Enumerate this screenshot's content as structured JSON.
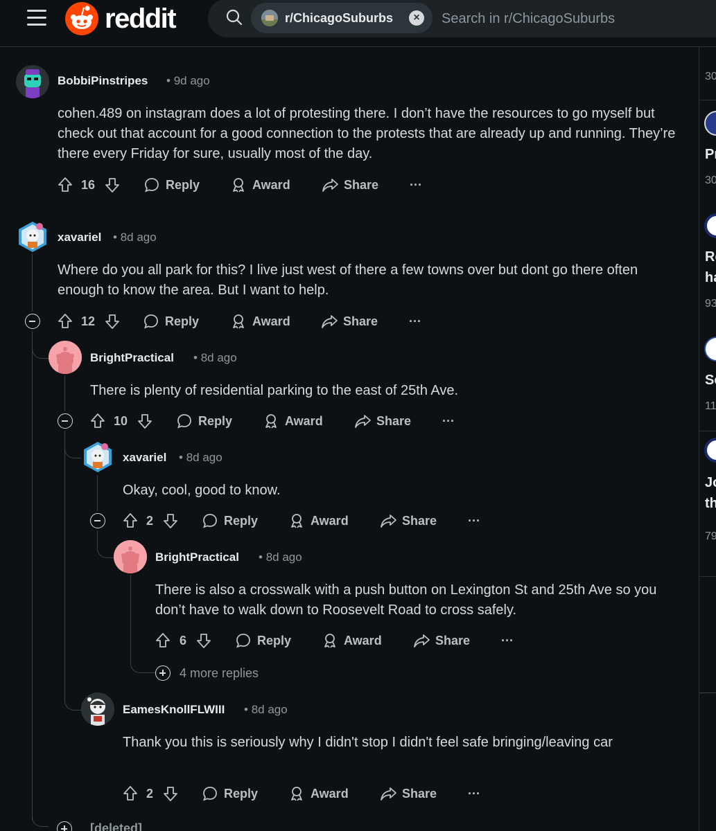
{
  "header": {
    "logo_text": "reddit",
    "search_chip_label": "r/ChicagoSuburbs",
    "search_chip_close": "×",
    "search_placeholder": "Search in r/ChicagoSuburbs"
  },
  "sidebar": {
    "items": [
      {
        "title": "P",
        "meta": "30"
      },
      {
        "title": "Pr",
        "meta": "30"
      },
      {
        "title": "Re",
        "title2": "ha",
        "meta": "93"
      },
      {
        "title": "Sc",
        "meta": "11"
      },
      {
        "title": "Jo",
        "title2": "th",
        "meta": "79"
      }
    ],
    "top_meta": "30"
  },
  "actions": {
    "reply": "Reply",
    "award": "Award",
    "share": "Share",
    "more": "···"
  },
  "comments": [
    {
      "username": "BobbiPinstripes",
      "age": "9d ago",
      "body": "cohen.489 on instagram does a lot of protesting there. I don’t have the resources to go myself but check out that account for a good connection to the protests that are already up and running. They’re there every Friday for sure, usually most of the day.",
      "votes": "16"
    },
    {
      "username": "xavariel",
      "age": "8d ago",
      "body": "Where do you all park for this? I live just west of there a few towns over but dont go there often enough to know the area. But I want to help.",
      "votes": "12"
    },
    {
      "username": "BrightPractical",
      "age": "8d ago",
      "body": "There is plenty of residential parking to the east of 25th Ave.",
      "votes": "10"
    },
    {
      "username": "xavariel",
      "age": "8d ago",
      "body": "Okay, cool, good to know.",
      "votes": "2"
    },
    {
      "username": "BrightPractical",
      "age": "8d ago",
      "body": "There is also a crosswalk with a push button on Lexington St and 25th Ave so you don’t have to walk down to Roosevelt Road to cross safely.",
      "votes": "6"
    },
    {
      "username": "EamesKnollFLWIII",
      "age": "8d ago",
      "body": "Thank you this is seriously why I didn't stop I didn't feel safe bringing/leaving car",
      "votes": "2"
    }
  ],
  "more_replies": "4 more replies",
  "deleted_label": "[deleted]",
  "colors": {
    "background": "#0e1113",
    "reddit_orange": "#ff4500",
    "text": "#d7dadc",
    "muted": "#8e979c"
  }
}
